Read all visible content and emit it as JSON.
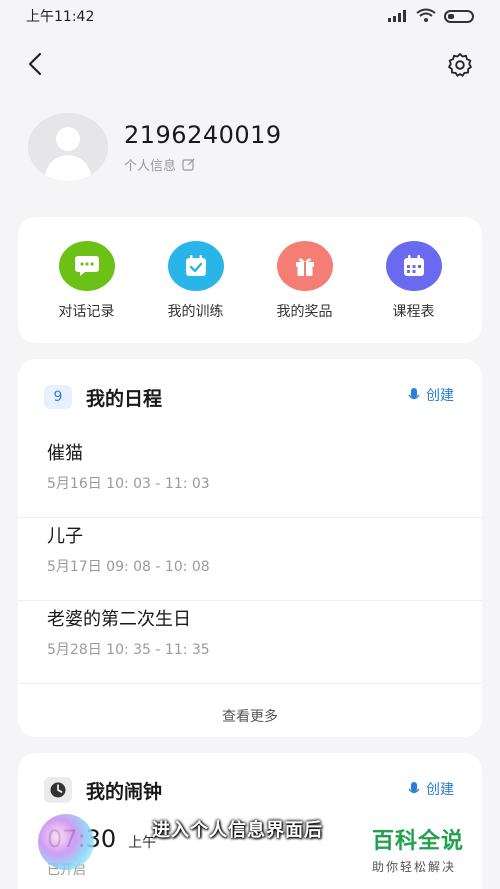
{
  "status_bar": {
    "time": "上午11:42",
    "icons": [
      "signal-icon",
      "wifi-icon",
      "battery-icon"
    ]
  },
  "nav": {
    "back_icon": "chevron-left-icon",
    "settings_icon": "gear-icon"
  },
  "profile": {
    "user_id": "2196240019",
    "info_link_label": "个人信息",
    "info_icon": "edit-icon"
  },
  "quick_actions": [
    {
      "label": "对话记录",
      "icon": "chat-icon",
      "color": "#6cc117"
    },
    {
      "label": "我的训练",
      "icon": "calendar-check-icon",
      "color": "#29b5e8"
    },
    {
      "label": "我的奖品",
      "icon": "gift-icon",
      "color": "#f47e73"
    },
    {
      "label": "课程表",
      "icon": "calendar-grid-icon",
      "color": "#6a6af0"
    }
  ],
  "schedule": {
    "day_badge": "9",
    "title": "我的日程",
    "create_label": "创建",
    "items": [
      {
        "title": "催猫",
        "time": "5月16日  10: 03 - 11: 03"
      },
      {
        "title": "儿子",
        "time": "5月17日  09: 08 - 10: 08"
      },
      {
        "title": "老婆的第二次生日",
        "time": "5月28日  10: 35 - 11: 35"
      }
    ],
    "more_label": "查看更多"
  },
  "alarm": {
    "title": "我的闹钟",
    "create_label": "创建",
    "time": "07:30",
    "ampm": "上午",
    "status": "已开启"
  },
  "overlay": {
    "subtitle": "进入个人信息界面后",
    "watermark_title": "百科全说",
    "watermark_sub": "助你轻松解决"
  },
  "colors": {
    "accent": "#2a7ed8",
    "watermark_green": "#1fa24b"
  }
}
